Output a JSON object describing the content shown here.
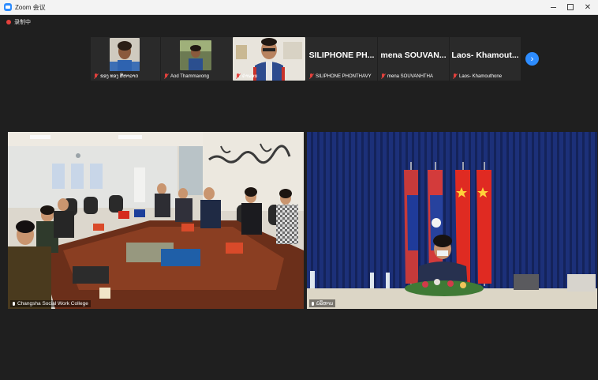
{
  "window": {
    "title": "Zoom 会议"
  },
  "recording": {
    "label": "录制中"
  },
  "thumbnails": [
    {
      "name": "ຂອງ ທອງ ສີຫາລາດ"
    },
    {
      "name": "Aod Thammavong"
    },
    {
      "name": "ຄຳພອນ"
    },
    {
      "display_name": "SILIPHONE PH...",
      "name": "SILIPHONE PHONTHAVY"
    },
    {
      "display_name": "mena SOUVAN...",
      "name": "mena SOUVANHTHA"
    },
    {
      "display_name": "Laos- Khamout...",
      "name": "Laos- Khamouthone"
    }
  ],
  "next_page": {
    "icon": "chevron-right-icon"
  },
  "video_left": {
    "label": "Changsha Social Work College"
  },
  "video_right": {
    "label": "ບໍລິຫານ"
  },
  "colors": {
    "accent": "#2d8cff",
    "recording": "#e5413c",
    "background": "#1f1f1f"
  }
}
